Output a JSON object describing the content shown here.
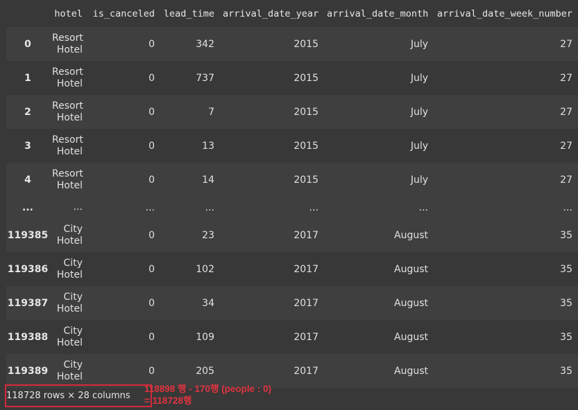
{
  "dataframe": {
    "columns": [
      "",
      "hotel",
      "is_canceled",
      "lead_time",
      "arrival_date_year",
      "arrival_date_month",
      "arrival_date_week_number"
    ],
    "rows": [
      {
        "index": "0",
        "hotel": "Resort Hotel",
        "is_canceled": "0",
        "lead_time": "342",
        "arrival_date_year": "2015",
        "arrival_date_month": "July",
        "arrival_date_week_number": "27"
      },
      {
        "index": "1",
        "hotel": "Resort Hotel",
        "is_canceled": "0",
        "lead_time": "737",
        "arrival_date_year": "2015",
        "arrival_date_month": "July",
        "arrival_date_week_number": "27"
      },
      {
        "index": "2",
        "hotel": "Resort Hotel",
        "is_canceled": "0",
        "lead_time": "7",
        "arrival_date_year": "2015",
        "arrival_date_month": "July",
        "arrival_date_week_number": "27"
      },
      {
        "index": "3",
        "hotel": "Resort Hotel",
        "is_canceled": "0",
        "lead_time": "13",
        "arrival_date_year": "2015",
        "arrival_date_month": "July",
        "arrival_date_week_number": "27"
      },
      {
        "index": "4",
        "hotel": "Resort Hotel",
        "is_canceled": "0",
        "lead_time": "14",
        "arrival_date_year": "2015",
        "arrival_date_month": "July",
        "arrival_date_week_number": "27"
      },
      {
        "index": "...",
        "hotel": "...",
        "is_canceled": "...",
        "lead_time": "...",
        "arrival_date_year": "...",
        "arrival_date_month": "...",
        "arrival_date_week_number": "...",
        "ellipsis": true
      },
      {
        "index": "119385",
        "hotel": "City Hotel",
        "is_canceled": "0",
        "lead_time": "23",
        "arrival_date_year": "2017",
        "arrival_date_month": "August",
        "arrival_date_week_number": "35"
      },
      {
        "index": "119386",
        "hotel": "City Hotel",
        "is_canceled": "0",
        "lead_time": "102",
        "arrival_date_year": "2017",
        "arrival_date_month": "August",
        "arrival_date_week_number": "35"
      },
      {
        "index": "119387",
        "hotel": "City Hotel",
        "is_canceled": "0",
        "lead_time": "34",
        "arrival_date_year": "2017",
        "arrival_date_month": "August",
        "arrival_date_week_number": "35"
      },
      {
        "index": "119388",
        "hotel": "City Hotel",
        "is_canceled": "0",
        "lead_time": "109",
        "arrival_date_year": "2017",
        "arrival_date_month": "August",
        "arrival_date_week_number": "35"
      },
      {
        "index": "119389",
        "hotel": "City Hotel",
        "is_canceled": "0",
        "lead_time": "205",
        "arrival_date_year": "2017",
        "arrival_date_month": "August",
        "arrival_date_week_number": "35"
      }
    ],
    "shape": "118728 rows × 28 columns"
  },
  "annotation": {
    "line1": "118898 행 - 170행 (people : 0)",
    "line2": "= 118728행",
    "color": "#e0333f"
  }
}
